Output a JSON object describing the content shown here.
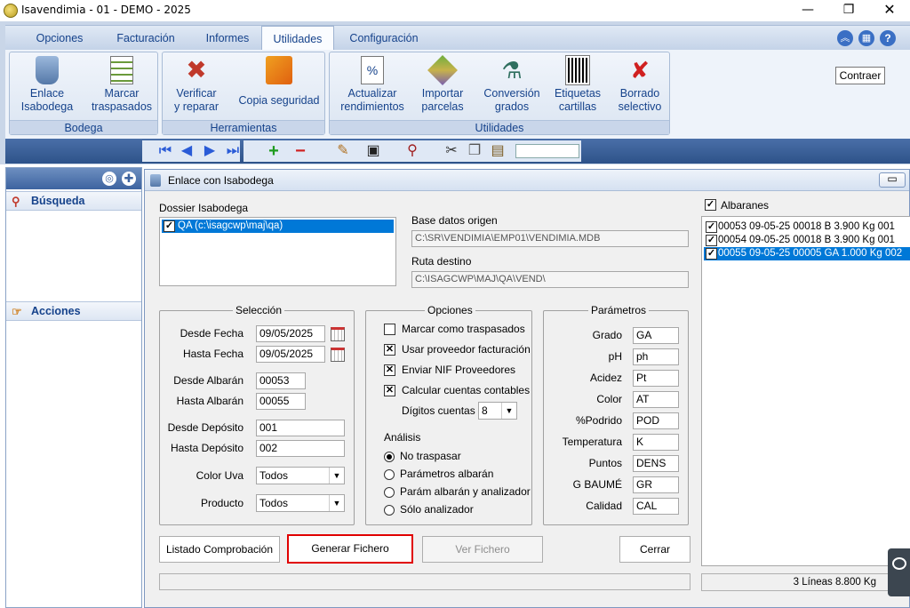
{
  "window": {
    "title": "Isavendimia - 01 - DEMO - 2025"
  },
  "menu": {
    "tabs": [
      "Opciones",
      "Facturación",
      "Informes",
      "Utilidades",
      "Configuración"
    ],
    "active": "Utilidades"
  },
  "ribbon": {
    "groups": [
      {
        "label": "Bodega",
        "buttons": [
          "Enlace\nIsabodega",
          "Marcar\ntraspasados"
        ]
      },
      {
        "label": "Herramientas",
        "buttons": [
          "Verificar\ny reparar",
          "Copia seguridad"
        ]
      },
      {
        "label": "Utilidades",
        "buttons": [
          "Actualizar\nrendimientos",
          "Importar\nparcelas",
          "Conversión\ngrados",
          "Etiquetas\ncartillas",
          "Borrado\nselectivo"
        ]
      }
    ],
    "tooltip": "Contraer"
  },
  "left_panel": {
    "busqueda": "Búsqueda",
    "acciones": "Acciones"
  },
  "form": {
    "title": "Enlace con Isabodega",
    "dossier_label": "Dossier Isabodega",
    "dossier_item": "QA  (c:\\isagcwp\\maj\\qa)",
    "base_datos_label": "Base datos origen",
    "base_datos_value": "C:\\SR\\VENDIMIA\\EMP01\\VENDIMIA.MDB",
    "ruta_label": "Ruta destino",
    "ruta_value": "C:\\ISAGCWP\\MAJ\\QA\\VEND\\",
    "seleccion": {
      "legend": "Selección",
      "desde_fecha_label": "Desde Fecha",
      "desde_fecha": "09/05/2025",
      "hasta_fecha_label": "Hasta Fecha",
      "hasta_fecha": "09/05/2025",
      "desde_albaran_label": "Desde Albarán",
      "desde_albaran": "00053",
      "hasta_albaran_label": "Hasta Albarán",
      "hasta_albaran": "00055",
      "desde_deposito_label": "Desde Depósito",
      "desde_deposito": "001",
      "hasta_deposito_label": "Hasta Depósito",
      "hasta_deposito": "002",
      "color_uva_label": "Color Uva",
      "color_uva": "Todos",
      "producto_label": "Producto",
      "producto": "Todos"
    },
    "opciones": {
      "legend": "Opciones",
      "marcar": "Marcar como traspasados",
      "marcar_checked": false,
      "usar": "Usar proveedor facturación",
      "usar_checked": true,
      "enviar": "Enviar NIF Proveedores",
      "enviar_checked": true,
      "calcular": "Calcular cuentas contables",
      "calcular_checked": true,
      "digitos_label": "Dígitos cuentas",
      "digitos": "8",
      "analisis_label": "Análisis",
      "radios": [
        "No traspasar",
        "Parámetros albarán",
        "Parám albarán y analizador",
        "Sólo analizador"
      ],
      "radio_selected": "No traspasar"
    },
    "parametros": {
      "legend": "Parámetros",
      "rows": [
        {
          "label": "Grado",
          "value": "GA"
        },
        {
          "label": "pH",
          "value": "ph"
        },
        {
          "label": "Acidez",
          "value": "Pt"
        },
        {
          "label": "Color",
          "value": "AT"
        },
        {
          "label": "%Podrido",
          "value": "POD"
        },
        {
          "label": "Temperatura",
          "value": "K"
        },
        {
          "label": "Puntos",
          "value": "DENS"
        },
        {
          "label": "G BAUMÉ",
          "value": "GR"
        },
        {
          "label": "Calidad",
          "value": "CAL"
        }
      ]
    },
    "buttons": {
      "listado": "Listado Comprobación",
      "generar": "Generar Fichero",
      "ver": "Ver Fichero",
      "cerrar": "Cerrar"
    },
    "albaranes": {
      "label": "Albaranes",
      "rows": [
        "00053  09-05-25  00018  B   3.900 Kg  001",
        "00054  09-05-25  00018  B   3.900 Kg  001",
        "00055  09-05-25  00005  GA  1.000 Kg  002"
      ],
      "footer": "3 Líneas    8.800 Kg"
    }
  },
  "colors": {
    "accent": "#15428b",
    "highlight": "#0078d7",
    "generar_border": "#e00000"
  }
}
